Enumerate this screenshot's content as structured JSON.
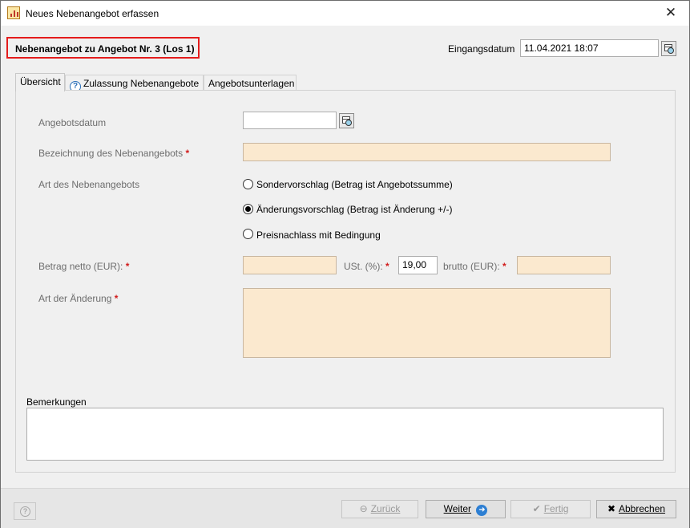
{
  "window": {
    "title": "Neues Nebenangebot erfassen",
    "close_symbol": "✕"
  },
  "header": {
    "title": "Nebenangebot zu Angebot Nr. 3 (Los 1)",
    "eingangsdatum_label": "Eingangsdatum",
    "eingangsdatum_value": "11.04.2021 18:07"
  },
  "tabs": [
    {
      "label": "Übersicht",
      "active": true
    },
    {
      "label": "Zulassung Nebenangebote",
      "icon": "help-icon"
    },
    {
      "label": "Angebotsunterlagen"
    }
  ],
  "form": {
    "angebotsdatum_label": "Angebotsdatum",
    "angebotsdatum_value": "",
    "bezeichnung_label": "Bezeichnung des Nebenangebots",
    "bezeichnung_value": "",
    "art_label": "Art des Nebenangebots",
    "options": [
      {
        "label": "Sondervorschlag (Betrag ist Angebotssumme)",
        "checked": false
      },
      {
        "label": "Änderungsvorschlag (Betrag ist Änderung +/-)",
        "checked": true
      },
      {
        "label": "Preisnachlass mit Bedingung",
        "checked": false
      }
    ],
    "betrag_label": "Betrag netto (EUR):",
    "betrag_value": "",
    "ust_label": "USt. (%):",
    "ust_value": "19,00",
    "brutto_label": "brutto (EUR):",
    "brutto_value": "",
    "art_aenderung_label": "Art der Änderung",
    "art_aenderung_value": "",
    "required_marker": "*",
    "bemerkungen_label": "Bemerkungen",
    "bemerkungen_value": ""
  },
  "buttons": {
    "help_symbol": "?",
    "zurueck_label": "Zurück",
    "weiter_label": "Weiter",
    "fertig_label": "Fertig",
    "abbrechen_label": "Abbrechen"
  },
  "colors": {
    "required_marker": "#d11c1c",
    "highlight_border": "#e41c1c",
    "required_field_bg": "#fbe9cf"
  }
}
